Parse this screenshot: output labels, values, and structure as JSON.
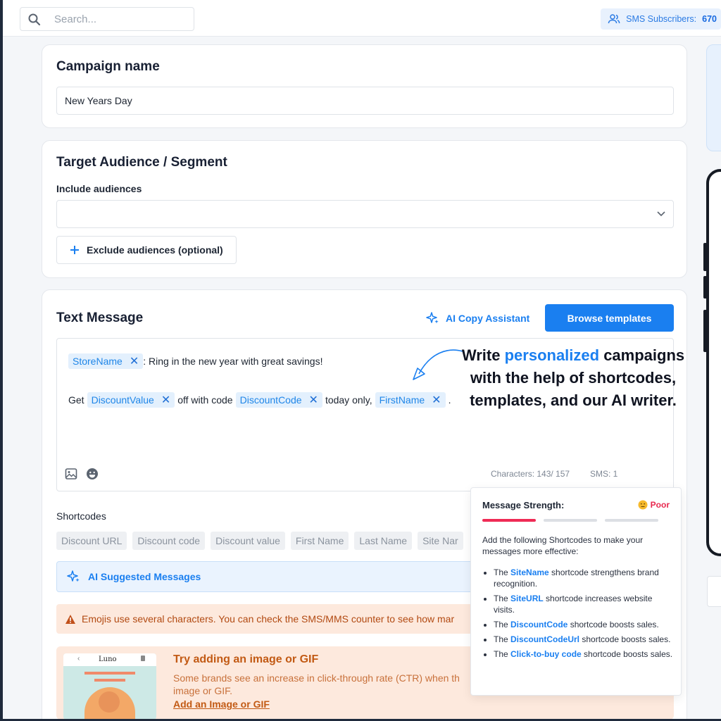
{
  "topbar": {
    "search_placeholder": "Search...",
    "subscribers_label": "SMS Subscribers:",
    "subscribers_count": "670"
  },
  "campaign": {
    "heading": "Campaign name",
    "value": "New Years Day"
  },
  "audience": {
    "heading": "Target Audience / Segment",
    "include_label": "Include audiences",
    "include_value": "",
    "exclude_button": "Exclude audiences (optional)"
  },
  "message": {
    "heading": "Text Message",
    "ai_copy_label": "AI Copy Assistant",
    "browse_label": "Browse templates",
    "line1": {
      "chip": "StoreName",
      "text": ": Ring in the new year with great savings!"
    },
    "line2": {
      "prefix": "Get",
      "chip1": "DiscountValue",
      "mid1": "off with code",
      "chip2": "DiscountCode",
      "mid2": "today only,",
      "chip3": "FirstName",
      "suffix": "."
    },
    "callout": {
      "part1": "Write ",
      "highlight": "personalized",
      "part2": " campaigns with the help of shortcodes, templates, and our AI writer."
    },
    "characters": "Characters: 143/ 157",
    "sms_count": "SMS: 1",
    "shortcodes_label": "Shortcodes",
    "shortcodes": [
      "Discount URL",
      "Discount code",
      "Discount value",
      "First Name",
      "Last Name",
      "Site Nar"
    ],
    "ai_suggested_label": "AI Suggested Messages",
    "emoji_warning": "Emojis use several characters. You can check the SMS/MMS counter to see how mar",
    "gif": {
      "title": "Try adding an image or GIF",
      "desc": "Some brands see an increase in click-through rate (CTR) when th image or GIF.",
      "link": "Add an Image or GIF",
      "thumb_brand": "Luno"
    }
  },
  "strength": {
    "title": "Message Strength:",
    "rating": "Poor",
    "rating_color": "#e8294f",
    "bars_filled": 1,
    "bars_total": 3,
    "intro": "Add the following Shortcodes to make your messages more effective:",
    "tips": [
      {
        "pre": "The ",
        "kw": "SiteName",
        "post": " shortcode strengthens brand recognition."
      },
      {
        "pre": "The ",
        "kw": "SiteURL",
        "post": " shortcode increases website visits."
      },
      {
        "pre": "The ",
        "kw": "DiscountCode",
        "post": " shortcode boosts sales."
      },
      {
        "pre": "The ",
        "kw": "DiscountCodeUrl",
        "post": " shortcode boosts sales."
      },
      {
        "pre": "The ",
        "kw": "Click-to-buy code",
        "post": " shortcode boosts sales."
      }
    ]
  },
  "colors": {
    "accent": "#1a7ff0",
    "warning_bg": "#fde9dd",
    "warning_text": "#b24a12"
  }
}
